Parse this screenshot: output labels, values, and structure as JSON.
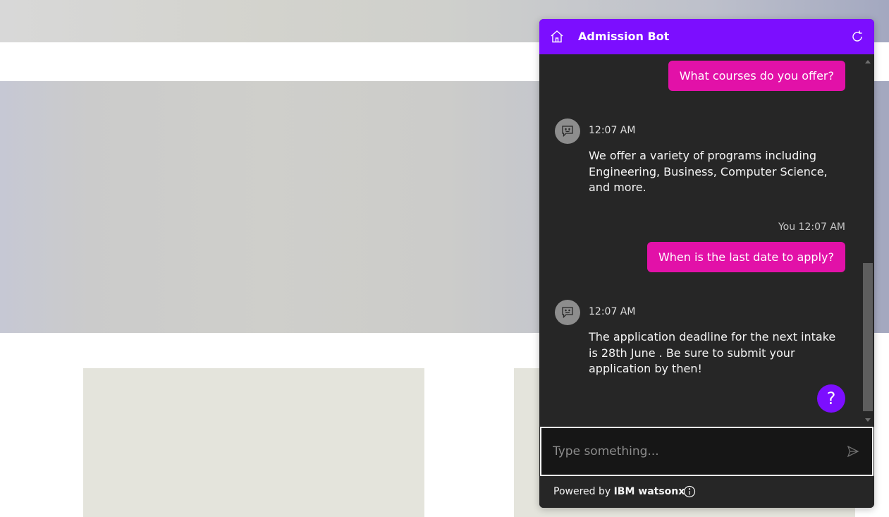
{
  "chat": {
    "title": "Admission Bot",
    "messages": {
      "user1": "What courses do you offer?",
      "bot1_time": "12:07 AM",
      "bot1_text": "We offer a variety of programs including Engineering, Business, Computer Science, and more.",
      "user2_meta": "You 12:07 AM",
      "user2": "When is the last date to apply?",
      "bot2_time": "12:07 AM",
      "bot2_text": "The application deadline for the next intake is 28th June . Be sure to submit your application by then!"
    },
    "help_label": "?",
    "input_placeholder": "Type something...",
    "footer_prefix": "Powered by ",
    "footer_brand": "IBM watsonx"
  },
  "icons": [
    "home-icon",
    "restart-icon",
    "bot-avatar-icon",
    "send-icon",
    "info-icon",
    "help-icon"
  ],
  "colors": {
    "header": "#7c0eff",
    "user_bubble": "#e211a8",
    "panel": "#262626",
    "input": "#161616"
  }
}
